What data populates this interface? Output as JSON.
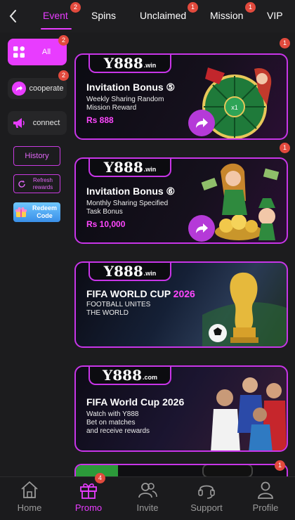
{
  "tabs": [
    {
      "label": "Event",
      "badge": "2",
      "active": true
    },
    {
      "label": "Spins",
      "badge": ""
    },
    {
      "label": "Unclaimed",
      "badge": "1"
    },
    {
      "label": "Mission",
      "badge": "1"
    },
    {
      "label": "VIP",
      "badge": ""
    }
  ],
  "sidebar": {
    "all": {
      "label": "All",
      "badge": "2"
    },
    "cooperate": {
      "label": "cooperate",
      "badge": "2"
    },
    "connect": {
      "label": "connect"
    },
    "history": "History",
    "refresh": "Refresh rewards",
    "redeem": "Redeem Code"
  },
  "banners": [
    {
      "logo": "Y888",
      "logo_suffix": ".win",
      "title": "Invitation Bonus ⑤",
      "sub1": "Weekly Sharing Random",
      "sub2": "Mission Reward",
      "amount": "Rs 888",
      "badge": "1"
    },
    {
      "logo": "Y888",
      "logo_suffix": ".win",
      "title": "Invitation Bonus ⑥",
      "sub1": "Monthly Sharing Specified",
      "sub2": "Task Bonus",
      "amount": "Rs 10,000",
      "badge": "1"
    },
    {
      "logo": "Y888",
      "logo_suffix": ".win",
      "title": "FIFA WORLD CUP",
      "title_year": "2026",
      "sub1": "FOOTBALL UNITES",
      "sub2": "THE WORLD"
    },
    {
      "logo": "Y888",
      "logo_suffix": ".com",
      "title": "FIFA World Cup 2026",
      "sub1": "Watch with Y888",
      "sub2": "Bet on matches",
      "sub3": "and receive rewards"
    }
  ],
  "partial_banner_badge": "1",
  "bottom_nav": [
    {
      "label": "Home",
      "icon": "home-icon"
    },
    {
      "label": "Promo",
      "icon": "gift-icon",
      "badge": "4",
      "active": true
    },
    {
      "label": "Invite",
      "icon": "invite-icon"
    },
    {
      "label": "Support",
      "icon": "headset-icon"
    },
    {
      "label": "Profile",
      "icon": "profile-icon"
    }
  ],
  "colors": {
    "accent": "#e83cff",
    "badge": "#e24a3d",
    "background": "#1c1c1e",
    "amount": "#ff47ff"
  }
}
